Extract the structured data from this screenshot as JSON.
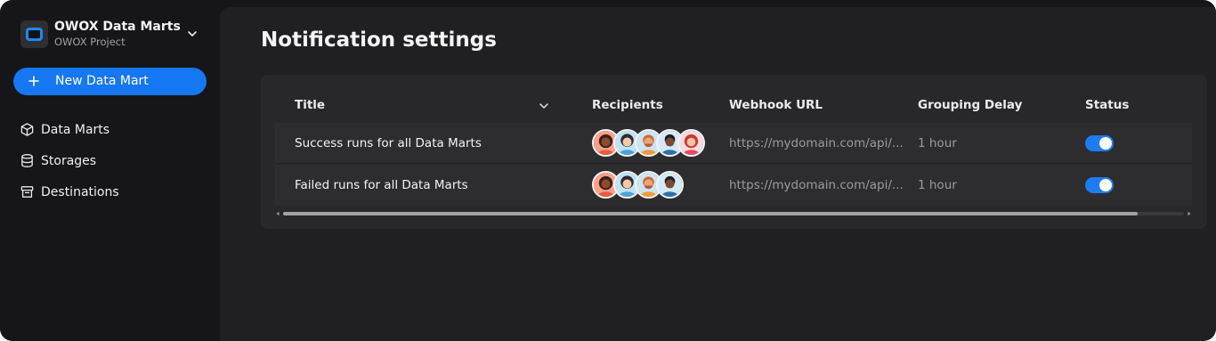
{
  "sidebar": {
    "brand": {
      "title": "OWOX Data Marts",
      "subtitle": "OWOX Project",
      "logo_icon": "data-marts-logo-icon",
      "menu_icon": "chevron-down-icon"
    },
    "new_button": {
      "label": "New Data Mart",
      "icon": "plus-icon"
    },
    "items": [
      {
        "label": "Data Marts",
        "icon": "cube-icon"
      },
      {
        "label": "Storages",
        "icon": "database-icon"
      },
      {
        "label": "Destinations",
        "icon": "archive-icon"
      }
    ]
  },
  "main": {
    "title": "Notification settings",
    "table": {
      "columns": [
        "Title",
        "Recipients",
        "Webhook URL",
        "Grouping Delay",
        "Status"
      ],
      "rows": [
        {
          "title": "Success runs for all Data Marts",
          "recipients": 5,
          "webhook_url": "https://mydomain.com/api/...",
          "grouping_delay": "1 hour",
          "status_enabled": true
        },
        {
          "title": "Failed runs for all Data Marts",
          "recipients": 4,
          "webhook_url": "https://mydomain.com/api/...",
          "grouping_delay": "1 hour",
          "status_enabled": true
        }
      ]
    }
  },
  "colors": {
    "accent": "#1677f2",
    "background": "#161618",
    "panel": "#202022",
    "card": "#28282b"
  }
}
